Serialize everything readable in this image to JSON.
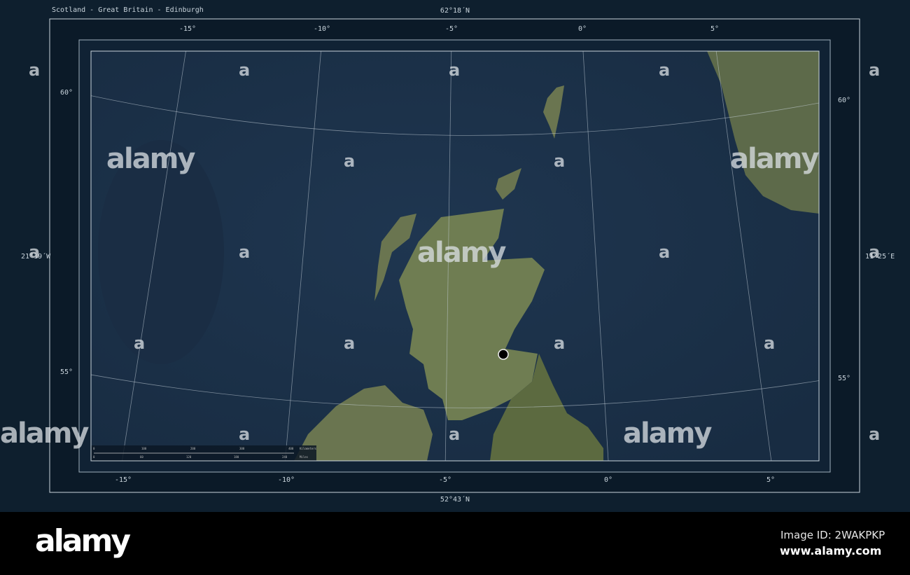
{
  "title": "Scotland - Great Britain - Edinburgh",
  "extent": {
    "north": "62°18´N",
    "south": "52°43´N",
    "west": "21°19´W",
    "east": "11°25´E"
  },
  "longitude_ticks": [
    "-15°",
    "-10°",
    "-5°",
    "0°",
    "5°"
  ],
  "latitude_ticks": [
    "60°",
    "55°"
  ],
  "capital": "Edinburgh",
  "scale_bar": {
    "km": [
      "0",
      "100",
      "200",
      "300",
      "400",
      "Kilometers"
    ],
    "miles": [
      "0",
      "60",
      "120",
      "180",
      "240",
      "Miles"
    ]
  },
  "watermark": "alamy",
  "watermark_small": "a",
  "footer": {
    "logo": "alamy",
    "image_id": "Image ID: 2WAKPKP",
    "site": "www.alamy.com"
  },
  "colors": {
    "ocean": "#1b3048",
    "land": "#6f7d52",
    "frame": "#c9d4dc",
    "background": "#0e1f2e"
  }
}
